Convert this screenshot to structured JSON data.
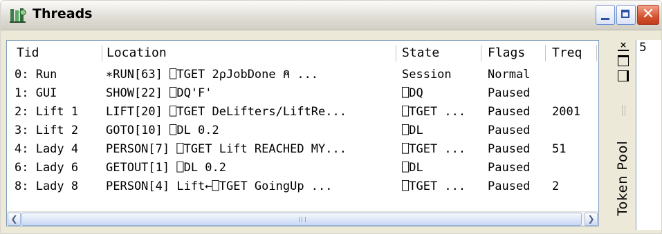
{
  "window": {
    "title": "Threads",
    "icon": "threads-app-icon",
    "controls": {
      "minimize": "minimize-icon",
      "maximize": "maximize-icon",
      "close": "close-icon"
    }
  },
  "table": {
    "columns": [
      {
        "key": "tid",
        "label": "Tid"
      },
      {
        "key": "location",
        "label": "Location"
      },
      {
        "key": "state",
        "label": "State"
      },
      {
        "key": "flags",
        "label": "Flags"
      },
      {
        "key": "treq",
        "label": "Treq"
      }
    ],
    "rows": [
      {
        "tid": "0: Run",
        "location": "∗RUN[63] ⎕TGET 2⍴JobDone    ⍝ ...",
        "state": "Session",
        "flags": "Normal",
        "treq": ""
      },
      {
        "tid": "1: GUI",
        "location": " SHOW[22] ⎕DQ'F'",
        "state": "⎕DQ",
        "flags": "Paused",
        "treq": ""
      },
      {
        "tid": "2: Lift 1",
        "location": " LIFT[20] ⎕TGET DeLifters/LiftRe...",
        "state": "⎕TGET ...",
        "flags": "Paused",
        "treq": "2001"
      },
      {
        "tid": "3: Lift 2",
        "location": " GOTO[10] ⎕DL 0.2",
        "state": "⎕DL",
        "flags": "Paused",
        "treq": ""
      },
      {
        "tid": "4: Lady 4",
        "location": " PERSON[7] ⎕TGET Lift REACHED MY...",
        "state": "⎕TGET ...",
        "flags": "Paused",
        "treq": "51"
      },
      {
        "tid": "6: Lady 6",
        "location": " GETOUT[1] ⎕DL 0.2",
        "state": "⎕DL",
        "flags": "Paused",
        "treq": ""
      },
      {
        "tid": "8: Lady 8",
        "location": " PERSON[4] Lift←⎕TGET GoingUp    ...",
        "state": "⎕TGET ...",
        "flags": "Paused",
        "treq": "2"
      }
    ]
  },
  "token_pool": {
    "label": "Token Pool",
    "value": "5"
  }
}
